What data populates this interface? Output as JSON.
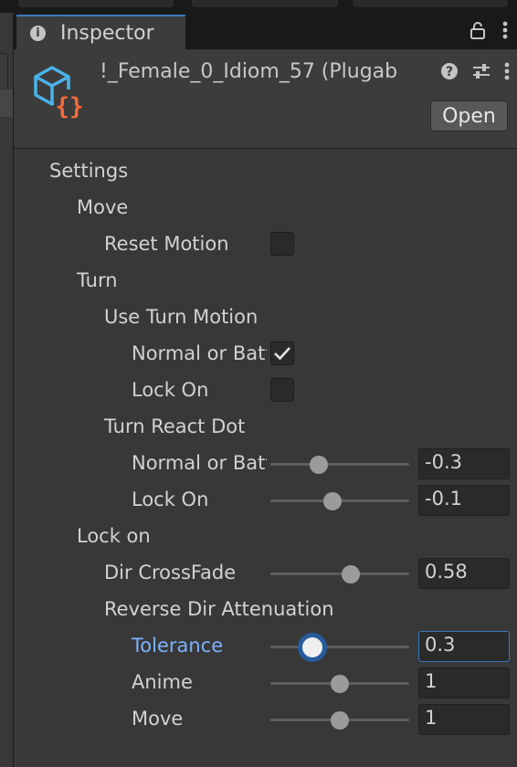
{
  "tab": {
    "title": "Inspector",
    "info_icon": "info-icon",
    "lock_icon": "lock-icon",
    "menu_icon": "kebab-menu-icon"
  },
  "header": {
    "asset_name": "!_Female_0_Idiom_57 (Plugab",
    "open_label": "Open",
    "asset_icon": "scriptable-object-icon",
    "help_icon": "help-icon",
    "presets_icon": "presets-icon",
    "menu_icon": "kebab-menu-icon"
  },
  "colors": {
    "accent": "#3a79bb",
    "focus_label": "#7cb2ff",
    "icon_cube": "#4ab3e8",
    "icon_braces": "#f26b3a"
  },
  "settings": {
    "label": "Settings",
    "move": {
      "label": "Move",
      "reset_motion": {
        "label": "Reset Motion",
        "checked": false
      }
    },
    "turn": {
      "label": "Turn",
      "use_turn_motion": {
        "label": "Use Turn Motion",
        "normal_or_battle": {
          "label": "Normal or Battle",
          "checked": true
        },
        "lock_on": {
          "label": "Lock On",
          "checked": false
        }
      },
      "turn_react_dot": {
        "label": "Turn React Dot",
        "normal_or_battle": {
          "label": "Normal or Battle",
          "value": "-0.3",
          "min": -1,
          "max": 1,
          "num": -0.3
        },
        "lock_on": {
          "label": "Lock On",
          "value": "-0.1",
          "min": -1,
          "max": 1,
          "num": -0.1
        }
      }
    },
    "lock_on": {
      "label": "Lock on",
      "dir_crossfade": {
        "label": "Dir CrossFade",
        "value": "0.58",
        "min": 0,
        "max": 1,
        "num": 0.58
      },
      "reverse_dir_attenuation": {
        "label": "Reverse Dir Attenuation",
        "tolerance": {
          "label": "Tolerance",
          "value": "0.3",
          "min": 0,
          "max": 1,
          "num": 0.3
        },
        "anime": {
          "label": "Anime",
          "value": "1",
          "min": 0,
          "max": 2,
          "num": 1
        },
        "move": {
          "label": "Move",
          "value": "1",
          "min": 0,
          "max": 2,
          "num": 1
        }
      }
    }
  }
}
